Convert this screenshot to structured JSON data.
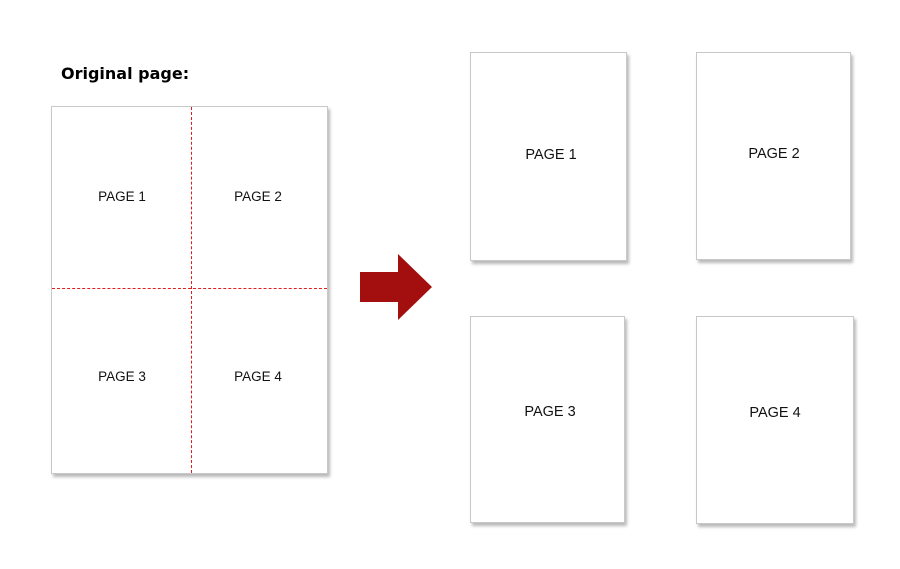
{
  "heading": "Original page:",
  "original_page": {
    "labels": [
      "PAGE 1",
      "PAGE 2",
      "PAGE 3",
      "PAGE 4"
    ]
  },
  "result_pages": [
    {
      "label": "PAGE 1"
    },
    {
      "label": "PAGE 2"
    },
    {
      "label": "PAGE 3"
    },
    {
      "label": "PAGE 4"
    }
  ],
  "colors": {
    "cut_line": "#e01e1e",
    "arrow": "#a30f0f"
  }
}
